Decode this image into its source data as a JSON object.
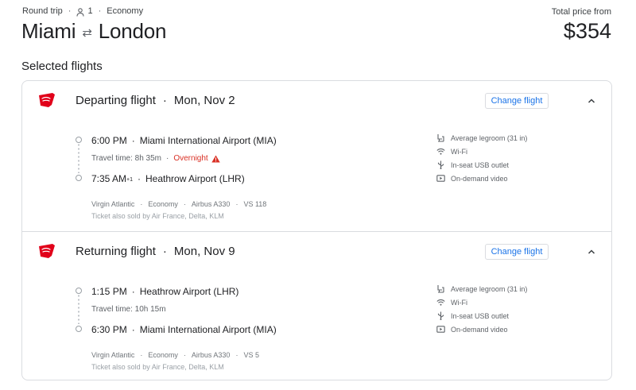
{
  "header": {
    "trip_type": "Round trip",
    "passengers": "1",
    "cabin": "Economy",
    "origin": "Miami",
    "destination": "London",
    "price_label": "Total price from",
    "price": "$354"
  },
  "section_title": "Selected flights",
  "change_label": "Change flight",
  "flights": [
    {
      "title": "Departing flight",
      "date": "Mon, Nov 2",
      "dep_time": "6:00 PM",
      "dep_airport": "Miami International Airport (MIA)",
      "travel_time": "Travel time: 8h 35m",
      "overnight": "Overnight",
      "arr_time": "7:35 AM",
      "arr_offset": "+1",
      "arr_airport": "Heathrow Airport (LHR)",
      "airline": "Virgin Atlantic",
      "cabin": "Economy",
      "aircraft": "Airbus A330",
      "flight_no": "VS 118",
      "sold_by": "Ticket also sold by Air France, Delta, KLM",
      "amenities": [
        "Average legroom (31 in)",
        "Wi-Fi",
        "In-seat USB outlet",
        "On-demand video"
      ]
    },
    {
      "title": "Returning flight",
      "date": "Mon, Nov 9",
      "dep_time": "1:15 PM",
      "dep_airport": "Heathrow Airport (LHR)",
      "travel_time": "Travel time: 10h 15m",
      "arr_time": "6:30 PM",
      "arr_airport": "Miami International Airport (MIA)",
      "airline": "Virgin Atlantic",
      "cabin": "Economy",
      "aircraft": "Airbus A330",
      "flight_no": "VS 5",
      "sold_by": "Ticket also sold by Air France, Delta, KLM",
      "amenities": [
        "Average legroom (31 in)",
        "Wi-Fi",
        "In-seat USB outlet",
        "On-demand video"
      ]
    }
  ],
  "colors": {
    "accent": "#1a73e8",
    "warning": "#d93025",
    "airline_red": "#e1001a"
  }
}
